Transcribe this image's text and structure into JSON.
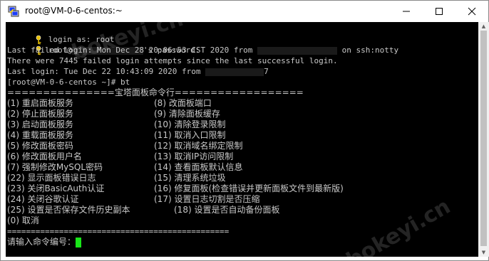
{
  "window": {
    "title": "root@VM-0-6-centos:~"
  },
  "terminal": {
    "login_as": "login as: root",
    "password_prefix": "root@",
    "password_suffix": "'s password:",
    "failed_prefix": "Last failed login: Mon Dec 28 20:06:53 CST 2020 from ",
    "failed_suffix": " on ssh:notty",
    "attempts": "There were 7445 failed login attempts since the last successful login.",
    "last_login_prefix": "Last login: Tue Dec 22 10:43:09 2020 from ",
    "last_login_suffix": "7",
    "prompt_cmd": "[root@VM-0-6-centos ~]# bt",
    "menu_header": "===============宝塔面板命令行==================",
    "menu": [
      [
        "(1) 重启面板服务",
        "(8) 改面板端口"
      ],
      [
        "(2) 停止面板服务",
        "(9) 清除面板缓存"
      ],
      [
        "(3) 启动面板服务",
        "(10) 清除登录限制"
      ],
      [
        "(4) 重载面板服务",
        "(11) 取消入口限制"
      ],
      [
        "(5) 修改面板密码",
        "(12) 取消域名绑定限制"
      ],
      [
        "(6) 修改面板用户名",
        "(13) 取消IP访问限制"
      ],
      [
        "(7) 强制修改MySQL密码",
        "(14) 查看面板默认信息"
      ],
      [
        "(22) 显示面板错误日志",
        "(15) 清理系统垃圾"
      ],
      [
        "(23) 关闭BasicAuth认证",
        "(16) 修复面板(检查错误并更新面板文件到最新版)"
      ],
      [
        "(24) 关闭谷歌认证",
        "(17) 设置日志切割是否压缩"
      ],
      [
        "(25) 设置是否保存文件历史副本",
        "(18) 设置是否自动备份面板"
      ]
    ],
    "menu_cancel": "(0) 取消",
    "menu_footer": "===============================================",
    "input_prompt": "请输入命令编号："
  },
  "watermark": {
    "text_1": "bokeyi.cn",
    "text_2": "bokeyi.cn"
  },
  "icons": {
    "app": "putty-icon",
    "key": "key-icon",
    "minimize": "minimize-icon",
    "maximize": "maximize-icon",
    "close": "close-icon"
  },
  "colors": {
    "terminal_bg": "#000000",
    "terminal_text": "#c8c8c8",
    "cursor": "#19e619"
  }
}
